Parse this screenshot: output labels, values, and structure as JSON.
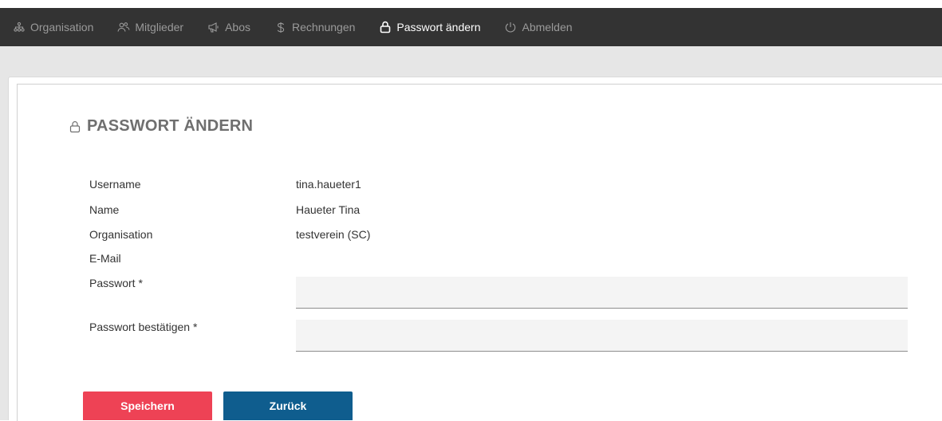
{
  "nav": {
    "items": [
      {
        "label": "Organisation",
        "icon": "org-chart-icon",
        "active": false
      },
      {
        "label": "Mitglieder",
        "icon": "members-icon",
        "active": false
      },
      {
        "label": "Abos",
        "icon": "megaphone-icon",
        "active": false
      },
      {
        "label": "Rechnungen",
        "icon": "dollar-icon",
        "active": false
      },
      {
        "label": "Passwort ändern",
        "icon": "lock-icon",
        "active": true
      },
      {
        "label": "Abmelden",
        "icon": "power-icon",
        "active": false
      }
    ]
  },
  "page": {
    "title": "PASSWORT ÄNDERN"
  },
  "fields": {
    "username_label": "Username",
    "username_value": "tina.haueter1",
    "name_label": "Name",
    "name_value": "Haueter Tina",
    "organisation_label": "Organisation",
    "organisation_value": "testverein (SC)",
    "email_label": "E-Mail",
    "email_value": "",
    "password_label": "Passwort *",
    "password_value": "",
    "confirm_label": "Passwort bestätigen *",
    "confirm_value": ""
  },
  "buttons": {
    "save_label": "Speichern",
    "back_label": "Zurück"
  },
  "colors": {
    "topbar": "#333333",
    "save": "#ee4255",
    "back": "#0f5d8e"
  }
}
